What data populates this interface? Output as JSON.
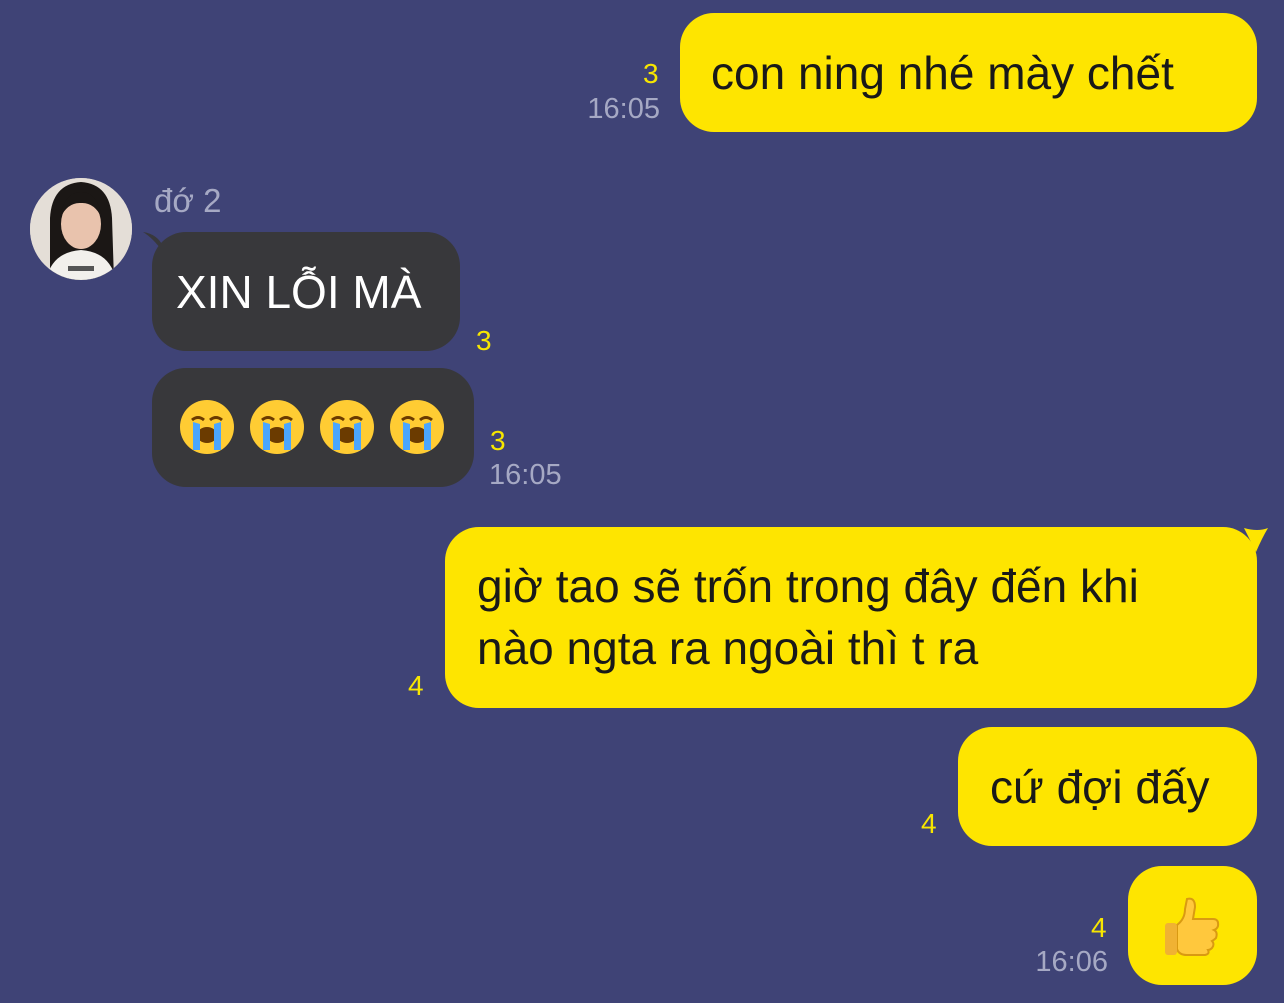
{
  "messages": [
    {
      "text": "con ning nhé mày chết",
      "unread": "3",
      "time": "16:05"
    },
    {
      "sender": "đớ 2",
      "text": "XIN LỖI MÀ",
      "unread": "3"
    },
    {
      "emoji": [
        "crying-face",
        "crying-face",
        "crying-face",
        "crying-face"
      ],
      "unread": "3",
      "time": "16:05"
    },
    {
      "line1": "giờ tao sẽ trốn trong đây đến khi",
      "line2": "nào ngta ra ngoài thì t ra",
      "unread": "4"
    },
    {
      "text": "cứ đợi đấy",
      "unread": "4"
    },
    {
      "emoji": "thumbs-up",
      "unread": "4",
      "time": "16:06"
    }
  ],
  "colors": {
    "background": "#3f4376",
    "outgoing_bubble": "#fee500",
    "incoming_bubble": "#38383b",
    "unread_count": "#f7e600",
    "timestamp": "#a6a9c4"
  }
}
